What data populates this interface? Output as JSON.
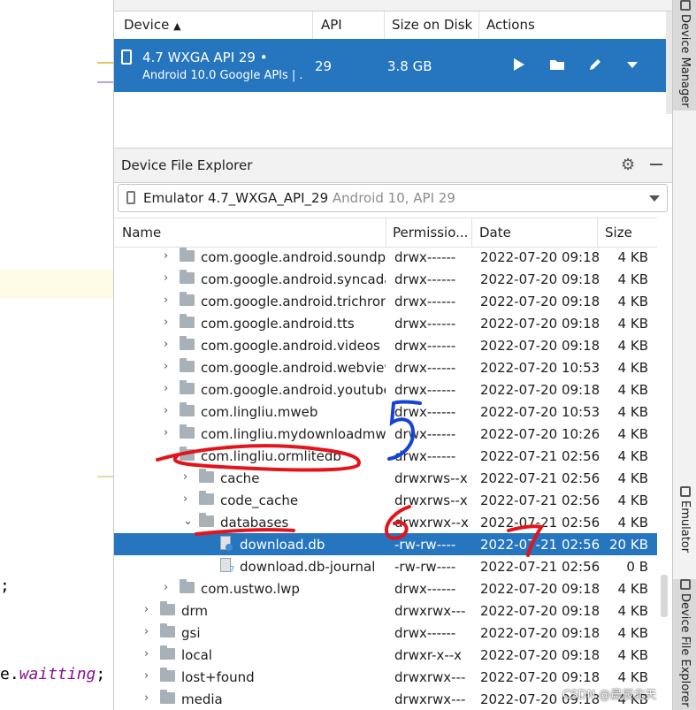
{
  "editor": {
    "code_line1": ";",
    "code_line2_prefix": "e.",
    "code_line2_field": "waitting",
    "code_line2_suffix": ";"
  },
  "device_manager": {
    "columns": {
      "device": "Device",
      "api": "API",
      "size": "Size on Disk",
      "actions": "Actions"
    },
    "device": {
      "title": "4.7  WXGA API 29  •",
      "subtitle": "Android 10.0 Google APIs | .",
      "api": "29",
      "size": "3.8 GB"
    },
    "actions": [
      "play-icon",
      "folder-icon",
      "pencil-icon",
      "dropdown-icon"
    ]
  },
  "file_explorer": {
    "title": "Device File Explorer",
    "device_selector": {
      "name": "Emulator 4.7_WXGA_API_29",
      "info": "Android 10, API 29"
    },
    "columns": {
      "name": "Name",
      "permissions": "Permissio...",
      "date": "Date",
      "size": "Size"
    },
    "rows": [
      {
        "level": 2,
        "type": "folder",
        "expand": "closed",
        "name": "com.google.android.soundp",
        "perm": "drwx------",
        "date": "2022-07-20 09:18",
        "size": "4 KB"
      },
      {
        "level": 2,
        "type": "folder",
        "expand": "closed",
        "name": "com.google.android.syncada",
        "perm": "drwx------",
        "date": "2022-07-20 09:18",
        "size": "4 KB"
      },
      {
        "level": 2,
        "type": "folder",
        "expand": "closed",
        "name": "com.google.android.trichron",
        "perm": "drwx------",
        "date": "2022-07-20 09:18",
        "size": "4 KB"
      },
      {
        "level": 2,
        "type": "folder",
        "expand": "closed",
        "name": "com.google.android.tts",
        "perm": "drwx------",
        "date": "2022-07-20 09:18",
        "size": "4 KB"
      },
      {
        "level": 2,
        "type": "folder",
        "expand": "closed",
        "name": "com.google.android.videos",
        "perm": "drwx------",
        "date": "2022-07-20 09:18",
        "size": "4 KB"
      },
      {
        "level": 2,
        "type": "folder",
        "expand": "closed",
        "name": "com.google.android.webview",
        "perm": "drwx------",
        "date": "2022-07-20 10:53",
        "size": "4 KB"
      },
      {
        "level": 2,
        "type": "folder",
        "expand": "closed",
        "name": "com.google.android.youtube",
        "perm": "drwx------",
        "date": "2022-07-20 09:18",
        "size": "4 KB"
      },
      {
        "level": 2,
        "type": "folder",
        "expand": "closed",
        "name": "com.lingliu.mweb",
        "perm": "drwx------",
        "date": "2022-07-20 10:53",
        "size": "4 KB"
      },
      {
        "level": 2,
        "type": "folder",
        "expand": "closed",
        "name": "com.lingliu.mydownloadmw",
        "perm": "drwx------",
        "date": "2022-07-20 10:26",
        "size": "4 KB"
      },
      {
        "level": 2,
        "type": "folder",
        "expand": "open",
        "name": "com.lingliu.ormlitedb",
        "perm": "drwx------",
        "date": "2022-07-21 02:56",
        "size": "4 KB"
      },
      {
        "level": 3,
        "type": "folder",
        "expand": "closed",
        "name": "cache",
        "perm": "drwxrws--x",
        "date": "2022-07-21 02:56",
        "size": "4 KB"
      },
      {
        "level": 3,
        "type": "folder",
        "expand": "closed",
        "name": "code_cache",
        "perm": "drwxrws--x",
        "date": "2022-07-21 02:56",
        "size": "4 KB"
      },
      {
        "level": 3,
        "type": "folder",
        "expand": "open",
        "name": "databases",
        "perm": "drwxrwx--x",
        "date": "2022-07-21 02:56",
        "size": "4 KB"
      },
      {
        "level": 4,
        "type": "file",
        "expand": "none",
        "name": "download.db",
        "perm": "-rw-rw----",
        "date": "2022-07-21 02:56",
        "size": "20 KB",
        "selected": true
      },
      {
        "level": 4,
        "type": "file-unknown",
        "expand": "none",
        "name": "download.db-journal",
        "perm": "-rw-rw----",
        "date": "2022-07-21 02:56",
        "size": "0 B"
      },
      {
        "level": 2,
        "type": "folder",
        "expand": "closed",
        "name": "com.ustwo.lwp",
        "perm": "drwx------",
        "date": "2022-07-20 09:18",
        "size": "4 KB"
      },
      {
        "level": 1,
        "type": "folder",
        "expand": "closed",
        "name": "drm",
        "perm": "drwxrwx---",
        "date": "2022-07-20 09:18",
        "size": "4 KB"
      },
      {
        "level": 1,
        "type": "folder",
        "expand": "closed",
        "name": "gsi",
        "perm": "drwx------",
        "date": "2022-07-20 09:18",
        "size": "4 KB"
      },
      {
        "level": 1,
        "type": "folder",
        "expand": "closed",
        "name": "local",
        "perm": "drwxr-x--x",
        "date": "2022-07-20 09:18",
        "size": "4 KB"
      },
      {
        "level": 1,
        "type": "folder",
        "expand": "closed",
        "name": "lost+found",
        "perm": "drwxrwx---",
        "date": "2022-07-20 09:18",
        "size": "4 KB"
      },
      {
        "level": 1,
        "type": "folder",
        "expand": "closed",
        "name": "media",
        "perm": "drwxrwx---",
        "date": "2022-07-20 09:18",
        "size": "4 KB"
      }
    ]
  },
  "side_tabs": {
    "device_manager": "Device Manager",
    "emulator": "Emulator",
    "device_file_explorer": "Device File Explorer"
  },
  "annotations": {
    "step5": "5",
    "step6": "6",
    "step7": "7"
  },
  "watermark": "CSDN @晨辰北天",
  "colors": {
    "selection": "#2675bf",
    "annotation_red": "#e3141b",
    "annotation_blue": "#1443d8"
  }
}
